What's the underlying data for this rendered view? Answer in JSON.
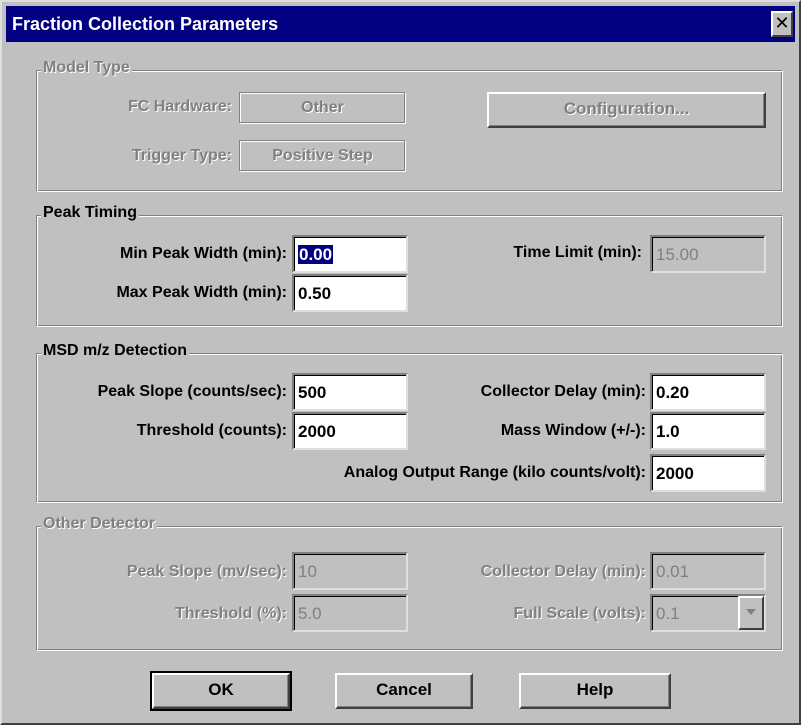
{
  "window": {
    "title": "Fraction Collection Parameters"
  },
  "model_type": {
    "title": "Model Type",
    "fc_hardware_label": "FC Hardware:",
    "fc_hardware_value": "Other",
    "trigger_type_label": "Trigger Type:",
    "trigger_type_value": "Positive Step",
    "configuration_label": "Configuration..."
  },
  "peak_timing": {
    "title": "Peak Timing",
    "min_peak_width_label": "Min Peak Width (min):",
    "min_peak_width_value": "0.00",
    "max_peak_width_label": "Max Peak Width (min):",
    "max_peak_width_value": "0.50",
    "time_limit_label": "Time Limit (min):",
    "time_limit_value": "15.00"
  },
  "msd": {
    "title": "MSD m/z Detection",
    "peak_slope_label": "Peak Slope (counts/sec):",
    "peak_slope_value": "500",
    "threshold_label": "Threshold (counts):",
    "threshold_value": "2000",
    "collector_delay_label": "Collector Delay (min):",
    "collector_delay_value": "0.20",
    "mass_window_label": "Mass Window (+/-):",
    "mass_window_value": "1.0",
    "analog_output_label": "Analog Output Range (kilo counts/volt):",
    "analog_output_value": "2000"
  },
  "other_detector": {
    "title": "Other Detector",
    "peak_slope_label": "Peak Slope (mv/sec):",
    "peak_slope_value": "10",
    "threshold_label": "Threshold (%):",
    "threshold_value": "5.0",
    "collector_delay_label": "Collector Delay (min):",
    "collector_delay_value": "0.01",
    "full_scale_label": "Full Scale (volts):",
    "full_scale_value": "0.1"
  },
  "buttons": {
    "ok": "OK",
    "cancel": "Cancel",
    "help": "Help"
  },
  "colors": {
    "titlebar": "#000080",
    "face": "#c0c0c0",
    "disabled_text": "#808080"
  }
}
